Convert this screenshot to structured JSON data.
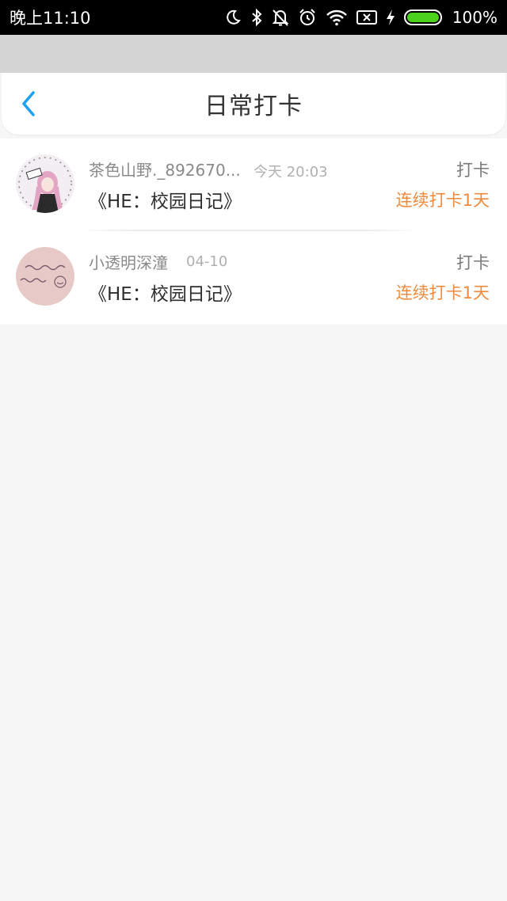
{
  "status_bar": {
    "time": "晚上11:10",
    "battery_percent": "100%",
    "icons": [
      "moon-icon",
      "bluetooth-icon",
      "mute-bell-icon",
      "alarm-icon",
      "wifi-icon",
      "no-sim-icon",
      "charging-icon",
      "battery-icon"
    ]
  },
  "header": {
    "title": "日常打卡",
    "back_icon": "chevron-left-icon"
  },
  "colors": {
    "accent_blue": "#1ea1f2",
    "streak_orange": "#f08a3c",
    "battery_green": "#4cd21c"
  },
  "checkins": [
    {
      "name": "茶色山野._892670...",
      "time": "今天 20:03",
      "book": "《HE：校园日记》",
      "action": "打卡",
      "streak": "连续打卡1天"
    },
    {
      "name": "小透明深潼",
      "time": "04-10",
      "book": "《HE：校园日记》",
      "action": "打卡",
      "streak": "连续打卡1天"
    }
  ]
}
